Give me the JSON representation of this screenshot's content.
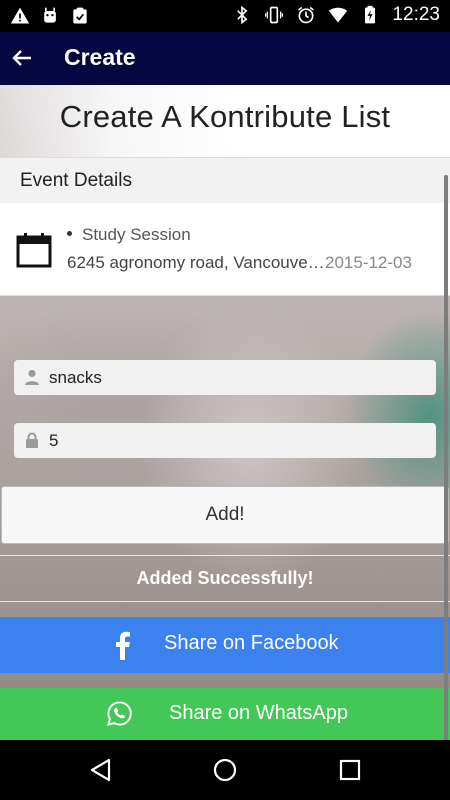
{
  "status_bar": {
    "time": "12:23",
    "left_icons": [
      "warning-icon",
      "android-icon",
      "clipboard-icon"
    ],
    "right_icons": [
      "bluetooth-icon",
      "vibrate-icon",
      "alarm-icon",
      "wifi-icon",
      "battery-charging-icon"
    ]
  },
  "action_bar": {
    "title": "Create",
    "back_icon": "arrow-left-icon"
  },
  "page": {
    "title": "Create A Kontribute List"
  },
  "event_details": {
    "header": "Event Details",
    "icon": "calendar-icon",
    "name": "Study Session",
    "address": "6245 agronomy road, Vancouve…",
    "date": "2015-12-03"
  },
  "form": {
    "item_value": "snacks",
    "item_icon": "person-icon",
    "quantity_value": "5",
    "quantity_icon": "lock-icon",
    "add_label": "Add!"
  },
  "feedback": {
    "message": "Added Successfully!"
  },
  "share": {
    "facebook_label": "Share on Facebook",
    "facebook_color": "#3b82ef",
    "whatsapp_label": "Share on WhatsApp",
    "whatsapp_color": "#43c857"
  },
  "nav_bar": {
    "icons": [
      "back-triangle-icon",
      "home-circle-icon",
      "recents-square-icon"
    ]
  }
}
